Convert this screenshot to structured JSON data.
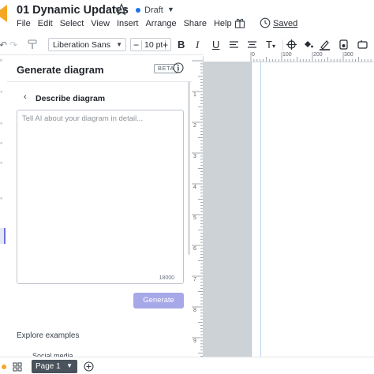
{
  "header": {
    "doc_title": "01 Dynamic Updates",
    "status": "Draft",
    "saved": "Saved"
  },
  "menu": [
    "File",
    "Edit",
    "Select",
    "View",
    "Insert",
    "Arrange",
    "Share",
    "Help"
  ],
  "toolbar": {
    "font": "Liberation Sans",
    "font_size": "10 pt",
    "minus": "−",
    "plus": "+",
    "bold": "B",
    "italic": "I",
    "underline": "U",
    "text_type": "T"
  },
  "panel": {
    "title": "Generate diagram",
    "badge": "BETA",
    "subtitle": "Describe diagram",
    "placeholder": "Tell AI about your diagram in detail...",
    "char_limit": "18000",
    "generate": "Generate",
    "explore": "Explore examples",
    "example_partial": "Social media"
  },
  "ruler": {
    "h_labels": [
      "0",
      "100",
      "200",
      "300"
    ],
    "v_labels": [
      "1",
      "2",
      "3",
      "4",
      "5",
      "6",
      "7",
      "8",
      "9"
    ]
  },
  "footer": {
    "page_tab": "Page 1"
  },
  "colors": {
    "accent": "#6b72d4",
    "generate_disabled": "#a7a8e8",
    "draft_dot": "#1a73e8",
    "logo": "#f5a623"
  }
}
